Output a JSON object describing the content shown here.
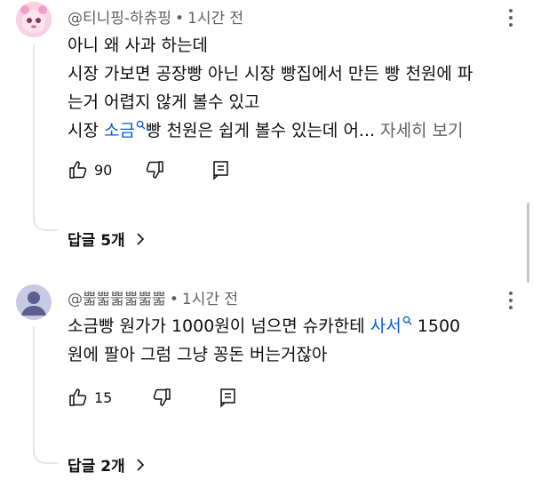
{
  "comments": [
    {
      "author": "@티니핑-하츄핑",
      "separator": "•",
      "time": "1시간 전",
      "lines": [
        "아니 왜 사과 하는데",
        "시장 가보면 공장빵 아닌 시장 빵집에서 만든 빵 천원에 파",
        "는거 어렵지 않게 볼수 있고"
      ],
      "last_line_prefix": "시장 ",
      "search_link": "소금",
      "last_line_suffix": "빵 천원은 쉽게 볼수 있는데  어...",
      "more_label": "자세히 보기",
      "likes": "90",
      "replies": "답글 5개"
    },
    {
      "author": "@뿗뿗뿗뿗뿗뿗",
      "separator": "•",
      "time": "1시간 전",
      "line1_prefix": "소금빵 원가가 1000원이 넘으면 슈카한테 ",
      "search_link": "사서",
      "line1_suffix": " 1500",
      "line2": "원에 팔아 그럼 그냥 꽁돈 버는거잖아",
      "likes": "15",
      "replies": "답글 2개"
    }
  ],
  "icons": {
    "like": "thumbs-up-icon",
    "dislike": "thumbs-down-icon",
    "reply": "reply-comment-icon",
    "more": "more-vertical-icon",
    "search": "search-icon",
    "chevron": "chevron-right-icon"
  },
  "colors": {
    "link": "#065fd4",
    "secondary": "#606060",
    "text": "#0f0f0f"
  }
}
